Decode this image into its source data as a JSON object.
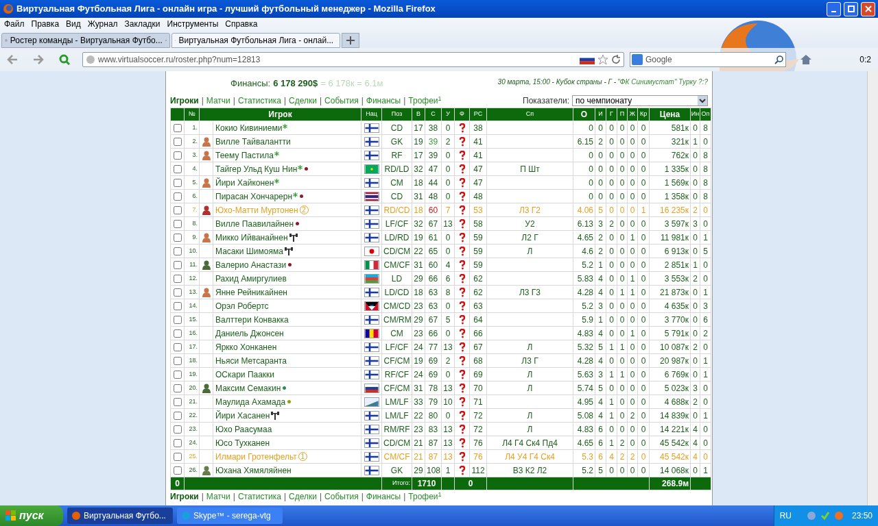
{
  "window": {
    "title": "Виртуальная Футбольная Лига - онлайн игра - лучший футбольный менеджер - Mozilla Firefox"
  },
  "menu": [
    "Файл",
    "Правка",
    "Вид",
    "Журнал",
    "Закладки",
    "Инструменты",
    "Справка"
  ],
  "tabs": [
    {
      "label": "Ростер команды - Виртуальная Футбо...",
      "selected": false
    },
    {
      "label": "Виртуальная Футбольная Лига - онлай...",
      "selected": true
    }
  ],
  "address": {
    "url": "www.virtualsoccer.ru/roster.php?num=12813"
  },
  "search": {
    "placeholder": "Google"
  },
  "toolbar_counter": "0:2",
  "page": {
    "finances_label": "Финансы:",
    "finances_value": "6 178 290$",
    "finances_short": "= 6 178к = 6.1м",
    "next_match": "30 марта, 15:00 - Кубок страны - Г - ",
    "next_match_team": "\"ФК Синимустат\" Турку ?:?",
    "nav": [
      {
        "label": "Игроки",
        "selected": true
      },
      {
        "separator": "|",
        "label": "Матчи",
        "selected": false
      },
      {
        "separator": "|",
        "label": "Статистика",
        "selected": false
      },
      {
        "separator": "|",
        "label": "Сделки",
        "selected": false
      },
      {
        "separator": "|",
        "label": "События",
        "selected": false
      },
      {
        "separator": "|",
        "label": "Финансы",
        "selected": false
      },
      {
        "separator": "|",
        "label": "Трофеи$^{1}$",
        "selected": false
      }
    ],
    "indicators_label": "Показатели:",
    "indicators_value": "по чемпионату",
    "nav_bottom": [
      {
        "label": "Игроки",
        "selected": true
      },
      {
        "separator": "|",
        "label": "Матчи",
        "selected": false
      },
      {
        "separator": "|",
        "label": "Статистика",
        "selected": false
      },
      {
        "separator": "|",
        "label": "Сделки",
        "selected": false
      },
      {
        "separator": "|",
        "label": "События",
        "selected": false
      },
      {
        "separator": "|",
        "label": "Финансы",
        "selected": false
      },
      {
        "separator": "|",
        "label": "Трофеи$^{1}$",
        "selected": false
      }
    ]
  },
  "table": {
    "columns": [
      "№",
      "Игрок",
      "Нац",
      "Поз",
      "В",
      "С",
      "У",
      "Ф",
      "РС",
      "Сп",
      "О",
      "И",
      "Г",
      "П",
      "Ж",
      "Кр",
      "Цена",
      "Ин",
      "Оп"
    ],
    "rows": [
      {
        "n": "1.",
        "name": "Кокио Кивиниеми",
        "star": true,
        "gym": false,
        "flag": {
          "kind": "finland"
        },
        "pos": "CD",
        "v": "17",
        "s": {
          "text": "38",
          "kind": "normal"
        },
        "u": "0",
        "rs": "38",
        "sp": "",
        "o": "0",
        "i": "0",
        "g": "0",
        "p": "0",
        "zh": "0",
        "kr": "0",
        "price": "581к",
        "in": "0",
        "op": "8",
        "highlight": false
      },
      {
        "n": "2.",
        "avatar": {
          "color": "#c8744a"
        },
        "name": "Вилле Тайвалантти",
        "star": false,
        "gym": false,
        "flag": {
          "kind": "finland"
        },
        "pos": "GK",
        "v": "19",
        "s": {
          "text": "39",
          "kind": "good"
        },
        "u": "2",
        "rs": "41",
        "sp": "",
        "o": "6.15",
        "i": "2",
        "g": "0",
        "p": "0",
        "zh": "0",
        "kr": "0",
        "price": "321к",
        "in": "1",
        "op": "0",
        "highlight": false
      },
      {
        "n": "3.",
        "avatar": {
          "color": "#c8744a"
        },
        "name": "Теему Пастила",
        "star": true,
        "gym": false,
        "flag": {
          "kind": "finland"
        },
        "pos": "RF",
        "v": "17",
        "s": {
          "text": "39",
          "kind": "normal"
        },
        "u": "0",
        "rs": "41",
        "sp": "",
        "o": "0",
        "i": "0",
        "g": "0",
        "p": "0",
        "zh": "0",
        "kr": "0",
        "price": "762к",
        "in": "0",
        "op": "8",
        "highlight": false
      },
      {
        "n": "4.",
        "name": "Тайгер Ульд Куш Нин",
        "star": true,
        "dot": {
          "color": "#8b1a2a"
        },
        "gym": false,
        "flag": {
          "kind": "mauritania"
        },
        "pos": "RD/LD",
        "v": "32",
        "s": {
          "text": "47",
          "kind": "normal"
        },
        "u": "0",
        "rs": "47",
        "sp": "П Шт",
        "o": "0",
        "i": "0",
        "g": "0",
        "p": "0",
        "zh": "0",
        "kr": "0",
        "price": "1 335к",
        "in": "0",
        "op": "8",
        "highlight": false
      },
      {
        "n": "5.",
        "avatar": {
          "color": "#c8744a"
        },
        "name": "Йири Хайконен",
        "star": true,
        "gym": false,
        "flag": {
          "kind": "finland"
        },
        "pos": "CM",
        "v": "18",
        "s": {
          "text": "44",
          "kind": "normal"
        },
        "u": "0",
        "rs": "47",
        "sp": "",
        "o": "0",
        "i": "0",
        "g": "0",
        "p": "0",
        "zh": "0",
        "kr": "0",
        "price": "1 569к",
        "in": "0",
        "op": "8",
        "highlight": false
      },
      {
        "n": "6.",
        "name": "Пирасан Хончарерн",
        "star": true,
        "dot": {
          "color": "#8b1a2a"
        },
        "gym": false,
        "flag": {
          "kind": "thailand"
        },
        "pos": "CD",
        "v": "31",
        "s": {
          "text": "48",
          "kind": "normal"
        },
        "u": "0",
        "rs": "48",
        "sp": "",
        "o": "0",
        "i": "0",
        "g": "0",
        "p": "0",
        "zh": "0",
        "kr": "0",
        "price": "1 358к",
        "in": "0",
        "op": "8",
        "highlight": false
      },
      {
        "n": "7.",
        "avatar": {
          "color": "#b03030"
        },
        "name": "Юхо-Матти Муртонен",
        "star": false,
        "badge": "2",
        "gym": false,
        "flag": {
          "kind": "finland"
        },
        "pos": "RD/CD",
        "v": "18",
        "s": {
          "text": "60",
          "kind": "bad"
        },
        "u": "7",
        "rs": "53",
        "sp": "Л3 Г2",
        "o": "4.06",
        "i": "5",
        "g": "0",
        "p": "0",
        "zh": "0",
        "kr": "1",
        "price": "16 235к",
        "in": "2",
        "op": "0",
        "highlight": true
      },
      {
        "n": "8.",
        "name": "Вилле Паавилайнен",
        "star": false,
        "dot": {
          "color": "#8b1a2a"
        },
        "gym": false,
        "flag": {
          "kind": "finland"
        },
        "pos": "LF/CF",
        "v": "32",
        "s": {
          "text": "67",
          "kind": "normal"
        },
        "u": "13",
        "rs": "58",
        "sp": "У2",
        "o": "6.13",
        "i": "3",
        "g": "2",
        "p": "0",
        "zh": "0",
        "kr": "0",
        "price": "3 597к",
        "in": "3",
        "op": "0",
        "highlight": false
      },
      {
        "n": "9.",
        "avatar": {
          "color": "#c8744a"
        },
        "name": "Микко Ийванайнен",
        "star": false,
        "gym": true,
        "flag": {
          "kind": "finland"
        },
        "pos": "LD/RD",
        "v": "19",
        "s": {
          "text": "61",
          "kind": "normal"
        },
        "u": "0",
        "rs": "59",
        "sp": "Л2 Г",
        "o": "4.65",
        "i": "2",
        "g": "0",
        "p": "0",
        "zh": "1",
        "kr": "0",
        "price": "11 981к",
        "in": "0",
        "op": "1",
        "highlight": false
      },
      {
        "n": "10.",
        "name": "Масаки Шимояма",
        "star": false,
        "gym": true,
        "flag": {
          "kind": "japan"
        },
        "pos": "CD/CM",
        "v": "22",
        "s": {
          "text": "65",
          "kind": "normal"
        },
        "u": "0",
        "rs": "59",
        "sp": "Л",
        "o": "4.6",
        "i": "2",
        "g": "0",
        "p": "0",
        "zh": "0",
        "kr": "0",
        "price": "6 913к",
        "in": "0",
        "op": "5",
        "highlight": false
      },
      {
        "n": "11.",
        "avatar": {
          "color": "#4a6a3a"
        },
        "name": "Валерио Анастази",
        "star": false,
        "dot": {
          "color": "#8b1a2a"
        },
        "gym": false,
        "flag": {
          "kind": "italy"
        },
        "pos": "CM/CF",
        "v": "31",
        "s": {
          "text": "60",
          "kind": "normal"
        },
        "u": "4",
        "rs": "59",
        "sp": "",
        "o": "5.2",
        "i": "1",
        "g": "0",
        "p": "0",
        "zh": "0",
        "kr": "0",
        "price": "2 851к",
        "in": "1",
        "op": "0",
        "highlight": false
      },
      {
        "n": "12.",
        "name": "Рахид Амиргулиев",
        "star": false,
        "gym": false,
        "flag": {
          "kind": "azerbaijan"
        },
        "pos": "LD",
        "v": "29",
        "s": {
          "text": "66",
          "kind": "normal"
        },
        "u": "6",
        "rs": "62",
        "sp": "",
        "o": "5.83",
        "i": "4",
        "g": "0",
        "p": "0",
        "zh": "1",
        "kr": "0",
        "price": "3 553к",
        "in": "2",
        "op": "0",
        "highlight": false
      },
      {
        "n": "13.",
        "avatar": {
          "color": "#c8744a"
        },
        "name": "Янне Рейникайнен",
        "star": false,
        "gym": false,
        "flag": {
          "kind": "finland"
        },
        "pos": "LD/CD",
        "v": "18",
        "s": {
          "text": "63",
          "kind": "normal"
        },
        "u": "8",
        "rs": "62",
        "sp": "Л3 Г3",
        "o": "4.28",
        "i": "4",
        "g": "0",
        "p": "1",
        "zh": "1",
        "kr": "0",
        "price": "21 873к",
        "in": "0",
        "op": "1",
        "highlight": false
      },
      {
        "n": "14.",
        "name": "Орэл Робертс",
        "star": false,
        "gym": false,
        "flag": {
          "kind": "antigua"
        },
        "pos": "CM/CD",
        "v": "23",
        "s": {
          "text": "63",
          "kind": "normal"
        },
        "u": "0",
        "rs": "63",
        "sp": "",
        "o": "5.2",
        "i": "3",
        "g": "0",
        "p": "0",
        "zh": "0",
        "kr": "0",
        "price": "4 635к",
        "in": "0",
        "op": "3",
        "highlight": false
      },
      {
        "n": "15.",
        "name": "Валттери Конвакка",
        "star": false,
        "gym": false,
        "flag": {
          "kind": "finland"
        },
        "pos": "CM/RM",
        "v": "29",
        "s": {
          "text": "67",
          "kind": "normal"
        },
        "u": "5",
        "rs": "64",
        "sp": "",
        "o": "5.9",
        "i": "1",
        "g": "0",
        "p": "0",
        "zh": "0",
        "kr": "0",
        "price": "3 770к",
        "in": "0",
        "op": "6",
        "highlight": false
      },
      {
        "n": "16.",
        "name": "Даниель Джонсен",
        "star": false,
        "gym": false,
        "flag": {
          "kind": "andorra"
        },
        "pos": "CM",
        "v": "23",
        "s": {
          "text": "66",
          "kind": "normal"
        },
        "u": "0",
        "rs": "66",
        "sp": "",
        "o": "4.83",
        "i": "4",
        "g": "0",
        "p": "0",
        "zh": "1",
        "kr": "0",
        "price": "5 791к",
        "in": "0",
        "op": "2",
        "highlight": false
      },
      {
        "n": "17.",
        "name": "Яркко Хонканен",
        "star": false,
        "gym": false,
        "flag": {
          "kind": "finland"
        },
        "pos": "LF/CF",
        "v": "24",
        "s": {
          "text": "77",
          "kind": "normal"
        },
        "u": "13",
        "rs": "67",
        "sp": "Л",
        "o": "5.32",
        "i": "5",
        "g": "1",
        "p": "1",
        "zh": "0",
        "kr": "0",
        "price": "10 087к",
        "in": "2",
        "op": "0",
        "highlight": false
      },
      {
        "n": "18.",
        "name": "Ньяси Метсаранта",
        "star": false,
        "gym": false,
        "flag": {
          "kind": "finland"
        },
        "pos": "CF/CM",
        "v": "19",
        "s": {
          "text": "69",
          "kind": "normal"
        },
        "u": "2",
        "rs": "68",
        "sp": "Л3 Г",
        "o": "4.28",
        "i": "4",
        "g": "0",
        "p": "0",
        "zh": "0",
        "kr": "0",
        "price": "20 987к",
        "in": "0",
        "op": "1",
        "highlight": false
      },
      {
        "n": "19.",
        "name": "ОСкари Паакки",
        "star": false,
        "gym": false,
        "flag": {
          "kind": "finland"
        },
        "pos": "RF/CF",
        "v": "24",
        "s": {
          "text": "69",
          "kind": "normal"
        },
        "u": "0",
        "rs": "69",
        "sp": "Л",
        "o": "5.63",
        "i": "3",
        "g": "1",
        "p": "1",
        "zh": "0",
        "kr": "0",
        "price": "6 769к",
        "in": "0",
        "op": "1",
        "highlight": false
      },
      {
        "n": "20.",
        "avatar": {
          "color": "#4a6a3a"
        },
        "name": "Максим Семакин",
        "star": false,
        "dot": {
          "color": "#2e8b57"
        },
        "gym": false,
        "flag": {
          "kind": "russia"
        },
        "pos": "CF/CM",
        "v": "31",
        "s": {
          "text": "78",
          "kind": "normal"
        },
        "u": "13",
        "rs": "70",
        "sp": "Л",
        "o": "5.74",
        "i": "5",
        "g": "0",
        "p": "0",
        "zh": "0",
        "kr": "0",
        "price": "5 023к",
        "in": "3",
        "op": "0",
        "highlight": false
      },
      {
        "n": "21.",
        "name": "Маулида Ахамада",
        "star": false,
        "dot": {
          "color": "#9a9a20"
        },
        "gym": false,
        "flag": {
          "kind": "comoros"
        },
        "pos": "LM/LF",
        "v": "33",
        "s": {
          "text": "79",
          "kind": "normal"
        },
        "u": "10",
        "rs": "71",
        "sp": "",
        "o": "4.95",
        "i": "4",
        "g": "1",
        "p": "0",
        "zh": "0",
        "kr": "0",
        "price": "4 688к",
        "in": "2",
        "op": "0",
        "highlight": false
      },
      {
        "n": "22.",
        "name": "Йири Хасанен",
        "star": false,
        "gym": true,
        "flag": {
          "kind": "finland"
        },
        "pos": "LM/LF",
        "v": "22",
        "s": {
          "text": "80",
          "kind": "normal"
        },
        "u": "0",
        "rs": "72",
        "sp": "Л",
        "o": "5.08",
        "i": "4",
        "g": "1",
        "p": "0",
        "zh": "2",
        "kr": "0",
        "price": "14 839к",
        "in": "0",
        "op": "1",
        "highlight": false
      },
      {
        "n": "23.",
        "name": "Юхо Раасумаа",
        "star": false,
        "gym": false,
        "flag": {
          "kind": "finland"
        },
        "pos": "RM/RF",
        "v": "23",
        "s": {
          "text": "83",
          "kind": "normal"
        },
        "u": "13",
        "rs": "72",
        "sp": "Л",
        "o": "4.83",
        "i": "6",
        "g": "0",
        "p": "0",
        "zh": "0",
        "kr": "0",
        "price": "14 221к",
        "in": "4",
        "op": "0",
        "highlight": false
      },
      {
        "n": "24.",
        "name": "Юсо Тухканен",
        "star": false,
        "gym": false,
        "flag": {
          "kind": "finland"
        },
        "pos": "CD/CM",
        "v": "21",
        "s": {
          "text": "87",
          "kind": "normal"
        },
        "u": "13",
        "rs": "76",
        "sp": "Л4 Г4 Ск4 Пд4",
        "o": "4.65",
        "i": "6",
        "g": "1",
        "p": "2",
        "zh": "0",
        "kr": "0",
        "price": "45 542к",
        "in": "4",
        "op": "0",
        "highlight": false
      },
      {
        "n": "25.",
        "name": "Илмари Гротенфельт",
        "star": false,
        "badge": "1",
        "gym": false,
        "flag": {
          "kind": "finland"
        },
        "pos": "CM/CF",
        "v": "21",
        "s": {
          "text": "87",
          "kind": "normal"
        },
        "u": "13",
        "rs": "76",
        "sp": "Л4 У4 Г4 Ск4",
        "o": "5.3",
        "i": "6",
        "g": "4",
        "p": "2",
        "zh": "2",
        "kr": "0",
        "price": "45 542к",
        "in": "4",
        "op": "0",
        "highlight": true
      },
      {
        "n": "26.",
        "avatar": {
          "color": "#6a7a4a"
        },
        "name": "Юхана Хямяляйнен",
        "star": false,
        "gym": false,
        "flag": {
          "kind": "finland"
        },
        "pos": "GK",
        "v": "29",
        "s": {
          "text": "108",
          "kind": "normal"
        },
        "u": "1",
        "rs": "112",
        "sp": "В3 К2 Л2",
        "o": "5.2",
        "i": "5",
        "g": "0",
        "p": "0",
        "zh": "0",
        "kr": "0",
        "price": "14 068к",
        "in": "0",
        "op": "1",
        "highlight": false
      }
    ],
    "totals": {
      "selected_count": "0",
      "label": "Итого:",
      "sum_s": "1710",
      "sum_f": "0",
      "sum_price": "268.9м"
    }
  },
  "taskbar": {
    "start": "пуск",
    "tasks": [
      {
        "label": "Виртуальная Футбо...",
        "selected": true
      },
      {
        "label": "Skype™ - serega-vtg",
        "selected": false
      }
    ],
    "language": "RU",
    "clock": "23:50"
  }
}
